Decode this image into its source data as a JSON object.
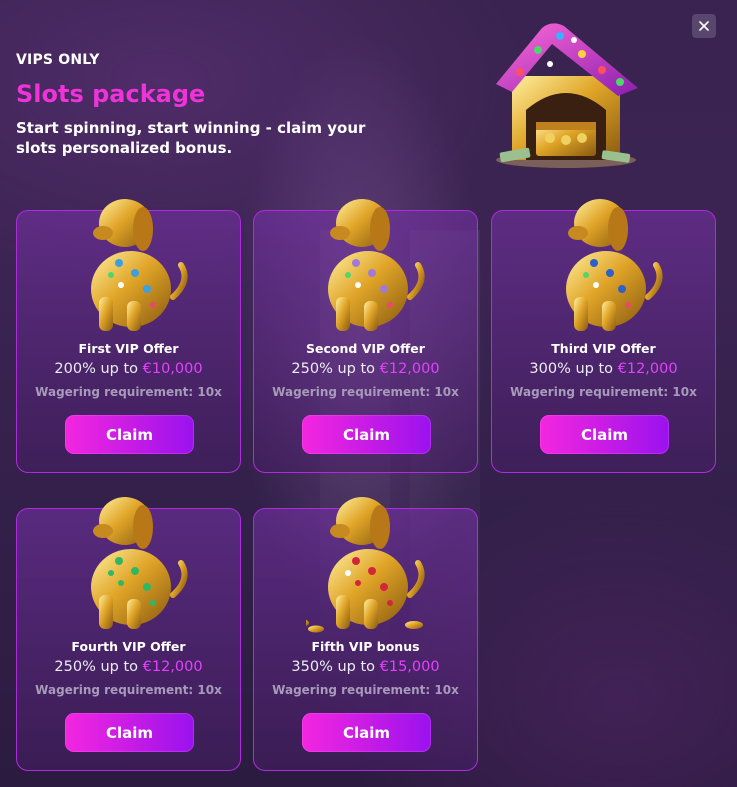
{
  "header": {
    "eyebrow": "VIPS ONLY",
    "title": "Slots package",
    "subtitle": "Start spinning, start winning - claim your slots personalized bonus."
  },
  "close_icon": "close-icon",
  "colors": {
    "accent": "#ee33d8",
    "amount": "#e640ff",
    "card_border": "#b02ae0",
    "button_start": "#f426e0",
    "button_end": "#9a12ee"
  },
  "offers": [
    {
      "name": "First VIP Offer",
      "percent": "200% up to ",
      "amount": "€10,000",
      "wagering": "Wagering requirement: 10x",
      "claim_label": "Claim",
      "gem_color": "#3aa0e0"
    },
    {
      "name": "Second VIP Offer",
      "percent": "250% up to ",
      "amount": "€12,000",
      "wagering": "Wagering requirement: 10x",
      "claim_label": "Claim",
      "gem_color": "#a07ad8"
    },
    {
      "name": "Third VIP Offer",
      "percent": "300% up to ",
      "amount": "€12,000",
      "wagering": "Wagering requirement: 10x",
      "claim_label": "Claim",
      "gem_color": "#2f5fc8"
    },
    {
      "name": "Fourth VIP Offer",
      "percent": "250% up to ",
      "amount": "€12,000",
      "wagering": "Wagering requirement: 10x",
      "claim_label": "Claim",
      "gem_color": "#2fb864"
    },
    {
      "name": "Fifth VIP bonus",
      "percent": "350% up to ",
      "amount": "€15,000",
      "wagering": "Wagering requirement: 10x",
      "claim_label": "Claim",
      "gem_color": "#d4263a"
    }
  ]
}
